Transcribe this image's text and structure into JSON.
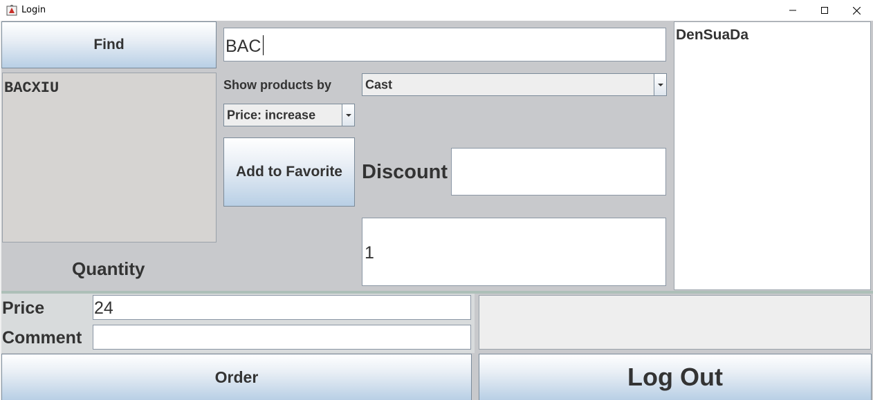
{
  "window": {
    "title": "Login",
    "controls": [
      "minimize-icon",
      "maximize-icon",
      "close-icon"
    ]
  },
  "find_button": "Find",
  "search_input": {
    "value": "BAC"
  },
  "product_list": {
    "items": [
      "BACXIU"
    ]
  },
  "show_by_label": "Show products by",
  "category_combo": {
    "selected": "Cast"
  },
  "sort_combo": {
    "selected": "Price: increase"
  },
  "favorite_button": "Add to Favorite",
  "discount": {
    "label": "Discount",
    "value": ""
  },
  "quantity": {
    "label": "Quantity",
    "value": "1"
  },
  "favorites_panel": {
    "items": [
      "DenSuaDa"
    ]
  },
  "price": {
    "label": "Price",
    "value": "24"
  },
  "comment": {
    "label": "Comment",
    "value": ""
  },
  "order_button": "Order",
  "logout_button": "Log Out",
  "colors": {
    "panel": "#c8c9cc",
    "bottom_panel": "#d8dbdc",
    "button_top": "#ffffff",
    "button_bottom": "#b8cfe5",
    "text": "#333333"
  }
}
